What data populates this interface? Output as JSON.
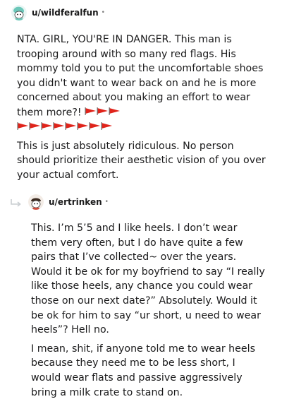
{
  "comments": [
    {
      "username": "u/wildferalfun",
      "separator": "•",
      "paragraphs": [
        "NTA. GIRL, YOU'RE IN DANGER. This man is trooping around with so many red flags. His mommy told you to put the uncomfortable shoes you didn't want to wear back on and he is more concerned about you making an effort to wear them more?!",
        "This is just absolutely ridiculous. No person should prioritize their aesthetic vision of you over your actual comfort."
      ],
      "flag_icon": "red-flag-icon",
      "flag_count_line1": 3,
      "flag_count_line2": 8,
      "avatar_icon": "snoo-avatar-icon"
    },
    {
      "username": "u/ertrinken",
      "separator": "•",
      "paragraphs": [
        "This. I’m 5’5 and I like heels. I don’t wear them very often, but I do have quite a few pairs that I’ve collected~ over the years. Would it be ok for my boyfriend to say “I really like those heels, any chance you could wear those on our next date?” Absolutely. Would it be ok for him to say “ur short, u need to wear heels”? Hell no.",
        "I mean, shit, if anyone told me to wear heels because they need me to be less short, I would wear flats and passive aggressively bring a milk crate to stand on."
      ],
      "avatar_icon": "snoo-avatar-icon",
      "reply_icon": "reply-arrow-icon"
    }
  ],
  "colors": {
    "text": "#1a1a1b",
    "meta": "#7c7c7c",
    "flag_red": "#e0241b",
    "avatar1": "#8fd3c8",
    "avatar2": "#3b2a20"
  }
}
